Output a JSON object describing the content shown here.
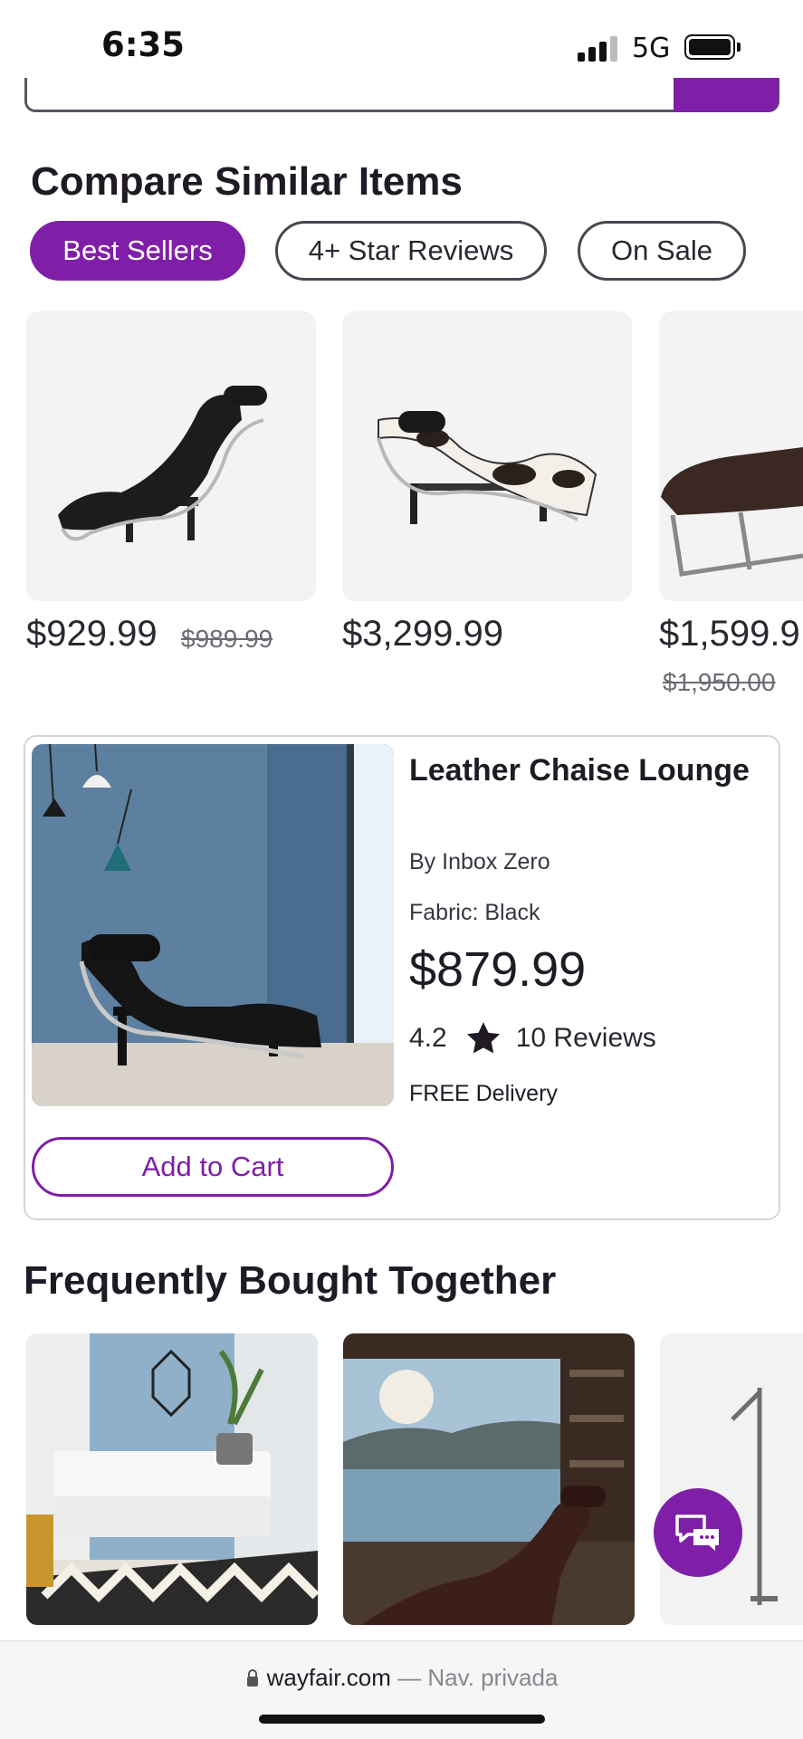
{
  "status_bar": {
    "time": "6:35",
    "network": "5G"
  },
  "compare": {
    "title": "Compare Similar Items",
    "filters": [
      "Best Sellers",
      "4+ Star Reviews",
      "On Sale"
    ],
    "items": [
      {
        "price": "$929.99",
        "old_price": "$989.99"
      },
      {
        "price": "$3,299.99",
        "old_price": ""
      },
      {
        "price": "$1,599.9",
        "old_price": "$1,950.00"
      }
    ]
  },
  "featured": {
    "title": "Leather Chaise Lounge",
    "brand": "By Inbox Zero",
    "fabric": "Fabric: Black",
    "price": "$879.99",
    "rating": "4.2",
    "rating_value": 4.2,
    "reviews": "10 Reviews",
    "delivery": "FREE Delivery",
    "add_to_cart": "Add to Cart"
  },
  "fbt": {
    "title": "Frequently Bought Together"
  },
  "browser": {
    "domain": "wayfair.com",
    "mode": "— Nav. privada"
  },
  "colors": {
    "accent": "#7f1fa8",
    "text": "#2b2730"
  },
  "icons": [
    "signal-icon",
    "battery-icon",
    "star-icon",
    "chat-icon",
    "lock-icon"
  ]
}
